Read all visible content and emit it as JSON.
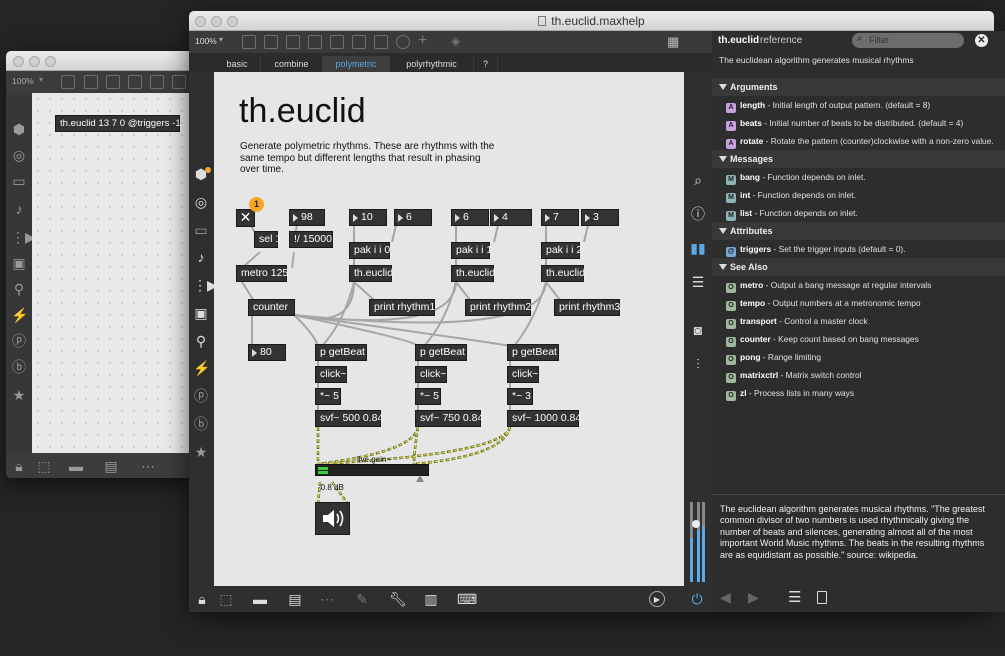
{
  "back_window": {
    "zoom": "100%",
    "object_text": "th.euclid 13 7 0 @triggers -1"
  },
  "main_window": {
    "title": "th.euclid.maxhelp",
    "zoom": "100%",
    "tabs": [
      "basic",
      "combine",
      "polymetric",
      "polyrhythmic",
      "?"
    ],
    "active_tab": "polymetric",
    "help_title": "th.euclid",
    "help_description": "Generate polymetric rhythms. These are rhythms with the same tempo but different lengths that result in phasing over time.",
    "badge": "1",
    "patch": {
      "num_98": "98",
      "sel": "sel 1",
      "div": "!/ 15000.",
      "metro": "metro 125",
      "counter": "counter",
      "num_80": "80",
      "n10": "10",
      "n6a": "6",
      "pak0": "pak i i 0",
      "euclid": "th.euclid",
      "print1": "print rhythm1",
      "n6b": "6",
      "n4": "4",
      "pak1": "pak i i 1",
      "print2": "print rhythm2",
      "n7": "7",
      "n3": "3",
      "pak2": "pak i i 2",
      "print3": "print rhythm3",
      "getbeat": "p getBeat",
      "click": "click~",
      "mul1": "*~ 5",
      "mul2": "*~ 5",
      "mul3": "*~ 3",
      "svf1": "svf~ 500 0.84",
      "svf2": "svf~ 750 0.84",
      "svf3": "svf~ 1000 0.84",
      "gain_label": "live.gain~",
      "gain_db": "-0.8 dB",
      "gain_level": 0.85
    }
  },
  "reference": {
    "name": "th.euclid",
    "suffix": "reference",
    "filter_placeholder": "Filter",
    "summary": "The euclidean algorithm generates musical rhythms",
    "sections": {
      "arguments": "Arguments",
      "messages": "Messages",
      "attributes": "Attributes",
      "see_also": "See Also"
    },
    "arguments": [
      {
        "name": "length",
        "desc": " - Initial length of output pattern. (default = 8)"
      },
      {
        "name": "beats",
        "desc": " - Initial number of beats to be distributed. (default = 4)"
      },
      {
        "name": "rotate",
        "desc": " - Rotate the pattern (counter)clockwise with a non-zero value. (..."
      }
    ],
    "messages": [
      {
        "name": "bang",
        "desc": " - Function depends on inlet."
      },
      {
        "name": "int",
        "desc": " - Function depends on inlet."
      },
      {
        "name": "list",
        "desc": " - Function depends on inlet."
      }
    ],
    "attributes": [
      {
        "name": "triggers",
        "desc": " - Set the trigger inputs (default = 0)."
      }
    ],
    "see_also": [
      {
        "name": "metro",
        "desc": " - Output a bang message at regular intervals"
      },
      {
        "name": "tempo",
        "desc": " - Output numbers at a metronomic tempo"
      },
      {
        "name": "transport",
        "desc": " - Control a master clock"
      },
      {
        "name": "counter",
        "desc": " - Keep count based on bang messages"
      },
      {
        "name": "pong",
        "desc": " - Range limiting"
      },
      {
        "name": "matrixctrl",
        "desc": " - Matrix switch control"
      },
      {
        "name": "zl",
        "desc": " - Process lists in many ways"
      }
    ],
    "description": "The euclidean algorithm generates musical rhythms. \"The greatest common divisor of two numbers is used rhythmically giving the number of beats and silences, generating almost all of the most important World Music rhythms. The beats in the resulting rhythms are as equidistant as possible.\" source: wikipedia."
  },
  "colors": {
    "accent": "#5aa9e6",
    "badge": "#f5a623",
    "meter": "#3ccf3c"
  }
}
